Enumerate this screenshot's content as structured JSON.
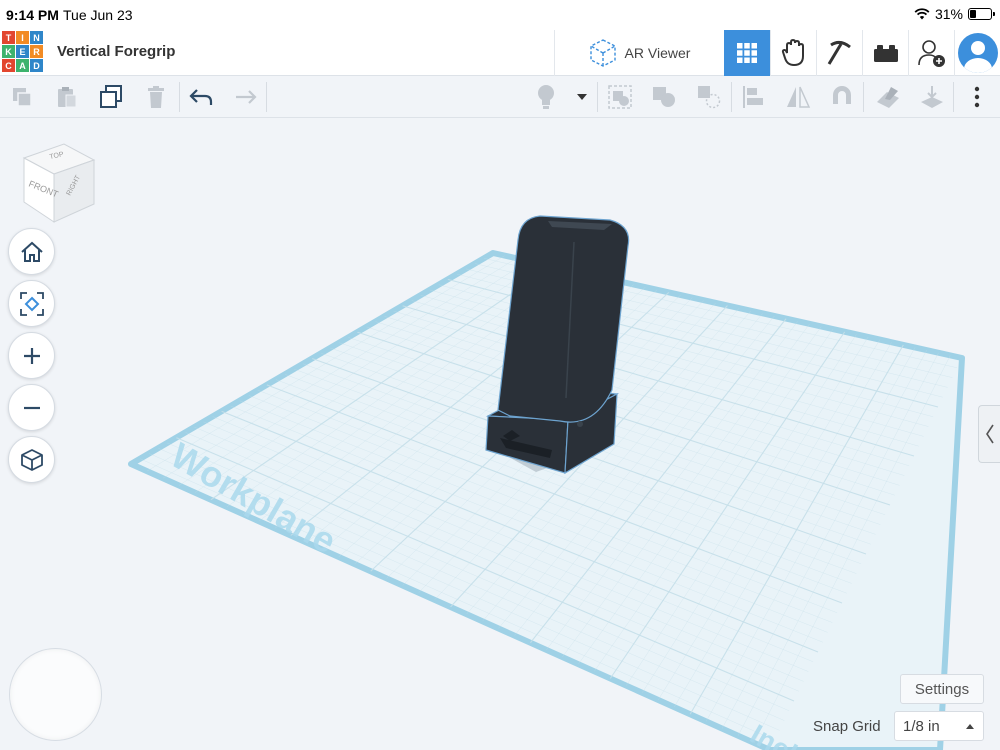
{
  "status": {
    "time": "9:14 PM",
    "date": "Tue Jun 23",
    "battery_text": "31%",
    "battery_level": 0.31
  },
  "logo": {
    "letters": [
      "T",
      "I",
      "N",
      "K",
      "E",
      "R",
      "C",
      "A",
      "D"
    ],
    "colors": [
      "#e2462f",
      "#f28b24",
      "#2f86c9",
      "#3db36d",
      "#2f86c9",
      "#f28b24",
      "#e2462f",
      "#3db36d",
      "#2f86c9"
    ]
  },
  "header": {
    "title": "Vertical Foregrip",
    "ar_label": "AR Viewer"
  },
  "colors": {
    "accent": "#3c8fdc",
    "workplane": "#e9f3f8",
    "workplane_border": "#9fd1e6",
    "grid_line": "#c5dfe9",
    "object": "#2a3038",
    "object_edge": "#6da3cf"
  },
  "toolbar": {
    "icons": [
      "copy-icon",
      "paste-icon",
      "duplicate-icon",
      "delete-icon",
      "undo-icon",
      "redo-icon",
      "light-icon",
      "dropdown-icon",
      "group-icon",
      "ungroup-icon",
      "hole-icon",
      "align-icon",
      "mirror-icon",
      "magnet-icon",
      "ruler-icon",
      "import-icon",
      "more-icon"
    ]
  },
  "viewcube": {
    "top": "TOP",
    "front": "FRONT",
    "right": "RIGHT"
  },
  "workplane": {
    "label": "Workplane",
    "corner_label": "Inch"
  },
  "settings": {
    "label": "Settings",
    "snap_label": "Snap Grid",
    "snap_value": "1/8 in"
  }
}
